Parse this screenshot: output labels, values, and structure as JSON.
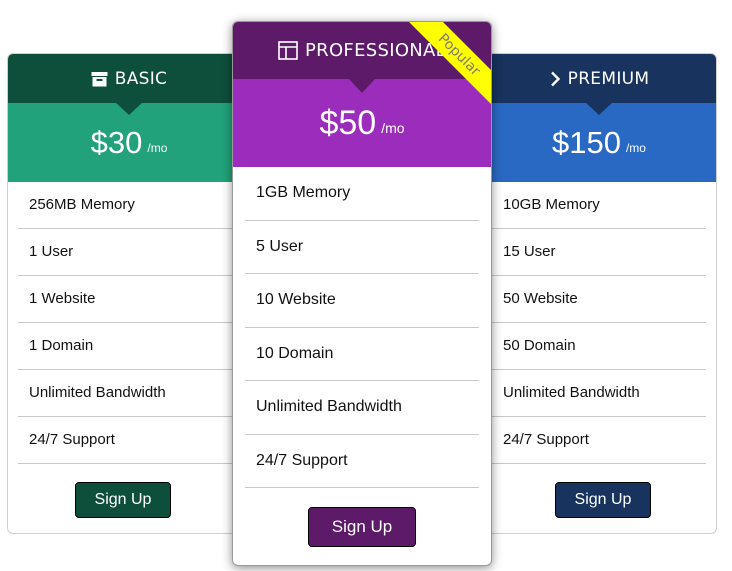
{
  "plans": [
    {
      "name": "BASIC",
      "icon": "archive-icon",
      "price": "$30",
      "period": "/mo",
      "features": [
        "256MB Memory",
        "1 User",
        "1 Website",
        "1 Domain",
        "Unlimited Bandwidth",
        "24/7 Support"
      ],
      "button_label": "Sign Up",
      "colors": {
        "header": "#0e4f3b",
        "price": "#21a27a"
      }
    },
    {
      "name": "PROFESSIONAL",
      "icon": "layout-icon",
      "price": "$50",
      "period": "/mo",
      "badge": "Popular",
      "features": [
        "1GB Memory",
        "5 User",
        "10 Website",
        "10 Domain",
        "Unlimited Bandwidth",
        "24/7 Support"
      ],
      "button_label": "Sign Up",
      "colors": {
        "header": "#5c1a68",
        "price": "#9b2cbc",
        "badge": "#ffff00"
      }
    },
    {
      "name": "PREMIUM",
      "icon": "chevron-right-icon",
      "price": "$150",
      "period": "/mo",
      "features": [
        "10GB Memory",
        "15 User",
        "50 Website",
        "50 Domain",
        "Unlimited Bandwidth",
        "24/7 Support"
      ],
      "button_label": "Sign Up",
      "colors": {
        "header": "#17335e",
        "price": "#2a69c3"
      }
    }
  ]
}
